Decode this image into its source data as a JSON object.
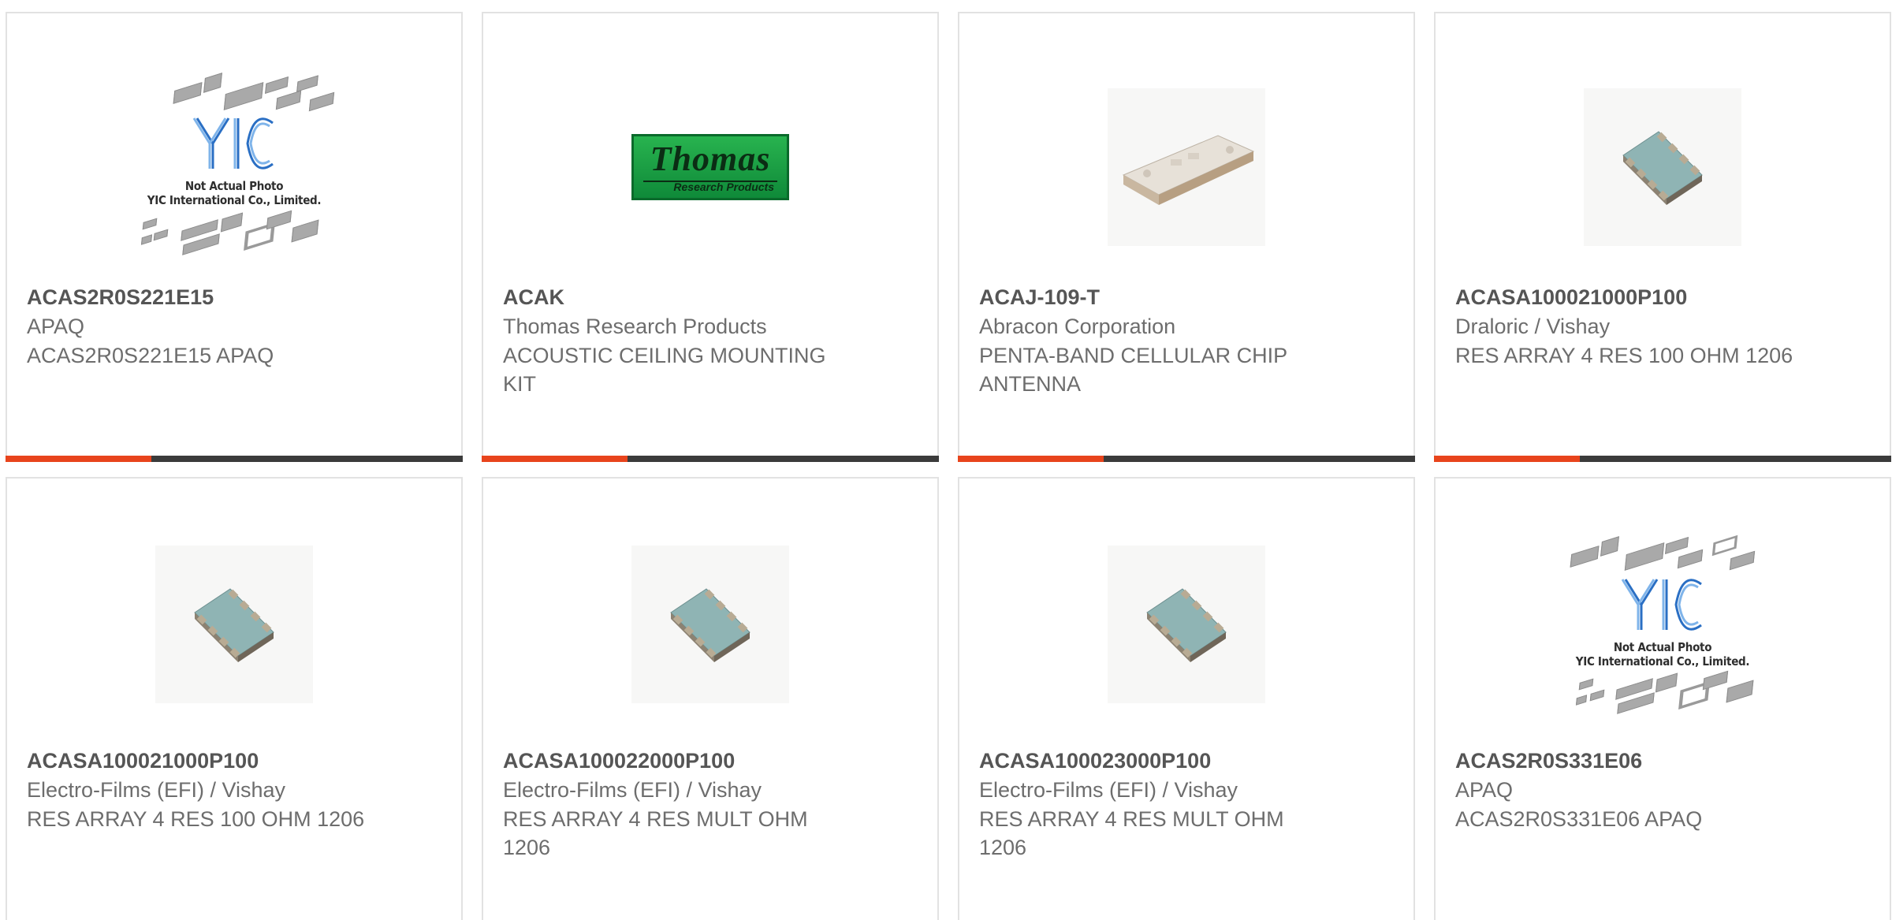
{
  "products": [
    {
      "part_number": "ACAS2R0S221E15",
      "manufacturer": "APAQ",
      "description": "ACAS2R0S221E15 APAQ",
      "image": "yic-not-actual-photo"
    },
    {
      "part_number": "ACAK",
      "manufacturer": "Thomas Research Products",
      "description": "ACOUSTIC CEILING MOUNTING KIT",
      "image": "thomas-logo"
    },
    {
      "part_number": "ACAJ-109-T",
      "manufacturer": "Abracon Corporation",
      "description": "PENTA-BAND CELLULAR CHIP ANTENNA",
      "image": "chip-antenna-photo"
    },
    {
      "part_number": "ACASA100021000P100",
      "manufacturer": "Draloric / Vishay",
      "description": "RES ARRAY 4 RES 100 OHM 1206",
      "image": "resistor-array-photo"
    },
    {
      "part_number": "ACASA100021000P100",
      "manufacturer": "Electro-Films (EFI) / Vishay",
      "description": "RES ARRAY 4 RES 100 OHM 1206",
      "image": "resistor-array-photo"
    },
    {
      "part_number": "ACASA100022000P100",
      "manufacturer": "Electro-Films (EFI) / Vishay",
      "description": "RES ARRAY 4 RES MULT OHM 1206",
      "image": "resistor-array-photo"
    },
    {
      "part_number": "ACASA100023000P100",
      "manufacturer": "Electro-Films (EFI) / Vishay",
      "description": "RES ARRAY 4 RES MULT OHM 1206",
      "image": "resistor-array-photo"
    },
    {
      "part_number": "ACAS2R0S331E06",
      "manufacturer": "APAQ",
      "description": "ACAS2R0S331E06 APAQ",
      "image": "yic-not-actual-photo"
    }
  ],
  "yic_placeholder": {
    "line1": "Not Actual Photo",
    "line2": "YIC International Co., Limited.",
    "logo_text": "YIC"
  },
  "thomas_logo": {
    "name": "Thomas",
    "tagline": "Research Products"
  },
  "colors": {
    "accent": "#e8441c",
    "bar": "#3b3b3b",
    "border": "#e2e2e2",
    "text": "#6d6d6d"
  }
}
